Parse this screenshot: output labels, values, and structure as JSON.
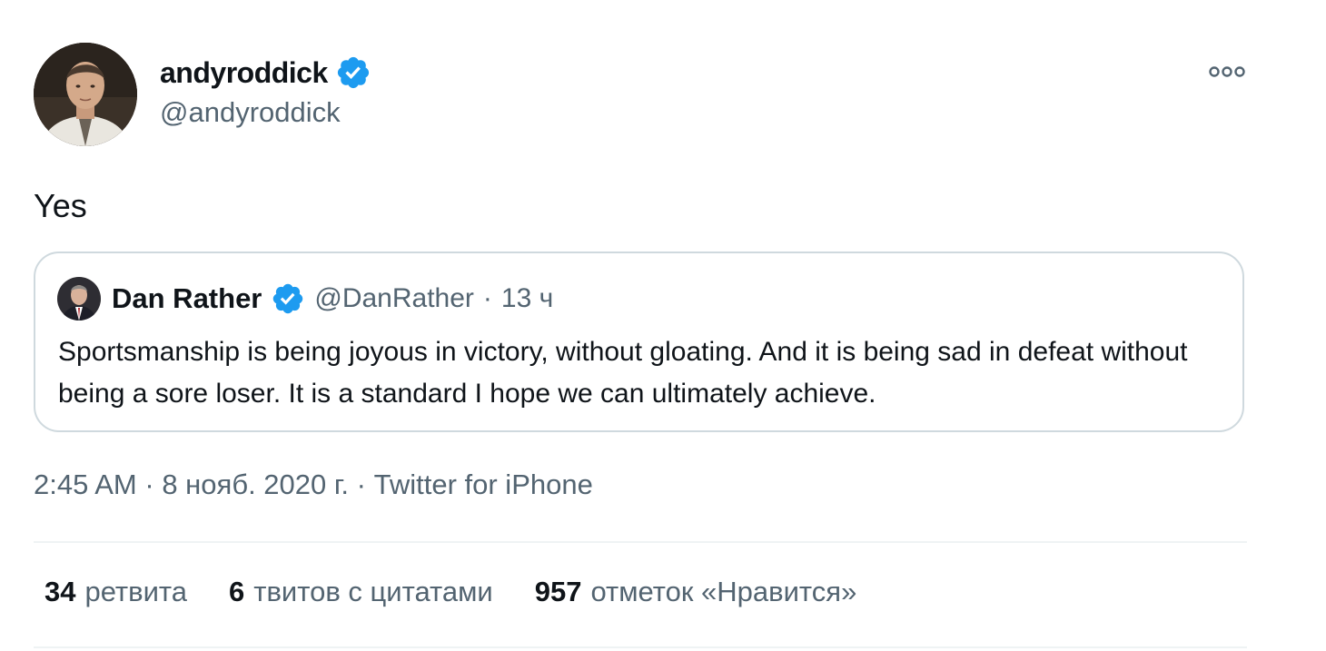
{
  "author": {
    "name": "andyroddick",
    "handle": "@andyroddick",
    "verified": true
  },
  "tweet": {
    "text": "Yes"
  },
  "quoted_tweet": {
    "name": "Dan Rather",
    "handle": "@DanRather",
    "separator": "·",
    "time": "13 ч",
    "verified": true,
    "text": "Sportsmanship is being joyous in victory, without gloating. And it is being sad in defeat without being a sore loser. It is a standard I hope we can ultimately achieve."
  },
  "meta": {
    "time": "2:45 AM",
    "separator": "·",
    "date": "8 нояб. 2020 г.",
    "source": "Twitter for iPhone"
  },
  "stats": [
    {
      "count": "34",
      "label": "ретвита"
    },
    {
      "count": "6",
      "label": "твитов с цитатами"
    },
    {
      "count": "957",
      "label": "отметок «Нравится»"
    }
  ],
  "icons": {
    "verified": "verified-badge-icon",
    "more": "more-options-icon"
  },
  "colors": {
    "verified_blue": "#1d9bf0",
    "secondary_text": "#536471",
    "border": "#cfd9de"
  }
}
